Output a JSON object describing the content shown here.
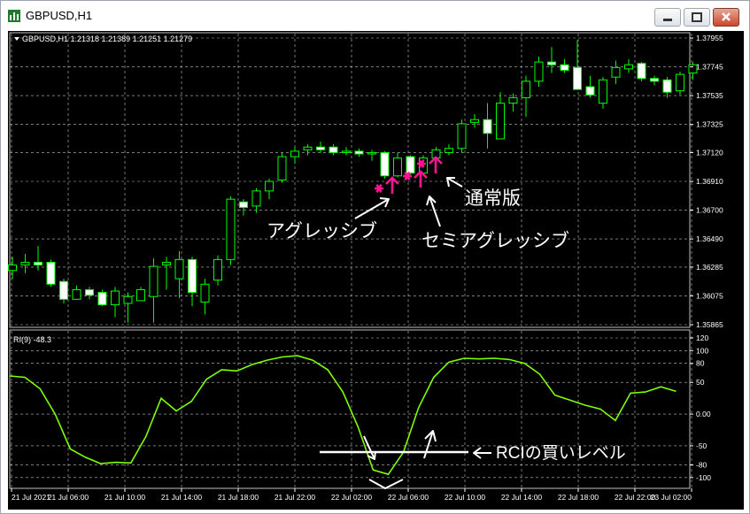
{
  "window": {
    "title": "GBPUSD,H1"
  },
  "colors": {
    "background": "#000000",
    "grid": "#c0c0c0",
    "candle_outline": "#00ff00",
    "candle_up_fill": "#000000",
    "candle_down_fill": "#ffffff",
    "rci_line": "#7fff00",
    "marker": "#ff1493",
    "annotation": "#ffffff"
  },
  "chart_data": [
    {
      "type": "candlestick",
      "symbol_header": "GBPUSD,H1  1.21318 1.21389 1.21251 1.21279",
      "ylim": [
        1.35865,
        1.37955
      ],
      "y_ticks": [
        "1.37955",
        "1.37745",
        "1.37535",
        "1.37325",
        "1.37120",
        "1.36910",
        "1.36700",
        "1.36490",
        "1.36285",
        "1.36075",
        "1.35865"
      ],
      "x_ticks": [
        "21 Jul 2021",
        "21 Jul 06:00",
        "21 Jul 10:00",
        "21 Jul 14:00",
        "21 Jul 18:00",
        "21 Jul 22:00",
        "22 Jul 02:00",
        "22 Jul 06:00",
        "22 Jul 10:00",
        "22 Jul 14:00",
        "22 Jul 18:00",
        "22 Jul 22:00",
        "23 Jul 02:00"
      ],
      "candles": [
        [
          1.3626,
          1.3636,
          1.362,
          1.363
        ],
        [
          1.363,
          1.3638,
          1.3624,
          1.3632
        ],
        [
          1.3632,
          1.3644,
          1.3626,
          1.363
        ],
        [
          1.3632,
          1.3634,
          1.3614,
          1.3616
        ],
        [
          1.3618,
          1.362,
          1.3602,
          1.3605
        ],
        [
          1.3605,
          1.3615,
          1.3605,
          1.3612
        ],
        [
          1.3612,
          1.3614,
          1.3605,
          1.3608
        ],
        [
          1.361,
          1.3612,
          1.36,
          1.3601
        ],
        [
          1.3601,
          1.3614,
          1.3592,
          1.3611
        ],
        [
          1.3602,
          1.361,
          1.3588,
          1.3607
        ],
        [
          1.3604,
          1.3614,
          1.3604,
          1.3612
        ],
        [
          1.3607,
          1.3635,
          1.3588,
          1.3629
        ],
        [
          1.363,
          1.3636,
          1.3612,
          1.3632
        ],
        [
          1.362,
          1.364,
          1.3606,
          1.3634
        ],
        [
          1.3634,
          1.3636,
          1.36,
          1.361
        ],
        [
          1.3603,
          1.362,
          1.3594,
          1.3616
        ],
        [
          1.3619,
          1.3637,
          1.3615,
          1.3634
        ],
        [
          1.3634,
          1.368,
          1.363,
          1.3678
        ],
        [
          1.3676,
          1.3678,
          1.3666,
          1.3672
        ],
        [
          1.3673,
          1.3686,
          1.3668,
          1.3684
        ],
        [
          1.3684,
          1.3693,
          1.3678,
          1.3691
        ],
        [
          1.3692,
          1.3712,
          1.369,
          1.3709
        ],
        [
          1.3709,
          1.3716,
          1.3704,
          1.3713
        ],
        [
          1.3714,
          1.3718,
          1.371,
          1.3716
        ],
        [
          1.3716,
          1.372,
          1.3712,
          1.3714
        ],
        [
          1.3716,
          1.3718,
          1.371,
          1.3712
        ],
        [
          1.3712,
          1.3716,
          1.371,
          1.3713
        ],
        [
          1.3713,
          1.3715,
          1.3709,
          1.3711
        ],
        [
          1.3711,
          1.3714,
          1.3706,
          1.3712
        ],
        [
          1.3712,
          1.3713,
          1.3693,
          1.3695
        ],
        [
          1.3695,
          1.3712,
          1.3694,
          1.3708
        ],
        [
          1.3709,
          1.371,
          1.3696,
          1.3697
        ],
        [
          1.3697,
          1.371,
          1.3696,
          1.3708
        ],
        [
          1.3708,
          1.3716,
          1.3704,
          1.3714
        ],
        [
          1.3712,
          1.3718,
          1.371,
          1.3715
        ],
        [
          1.3715,
          1.3736,
          1.3712,
          1.3733
        ],
        [
          1.3734,
          1.374,
          1.373,
          1.3736
        ],
        [
          1.3736,
          1.3748,
          1.3715,
          1.3726
        ],
        [
          1.3722,
          1.3756,
          1.3722,
          1.3748
        ],
        [
          1.3748,
          1.3755,
          1.3742,
          1.3752
        ],
        [
          1.3752,
          1.3768,
          1.3738,
          1.3764
        ],
        [
          1.3764,
          1.3782,
          1.376,
          1.3778
        ],
        [
          1.3778,
          1.3789,
          1.377,
          1.3776
        ],
        [
          1.3776,
          1.378,
          1.377,
          1.3772
        ],
        [
          1.3774,
          1.3794,
          1.3758,
          1.3758
        ],
        [
          1.376,
          1.3768,
          1.3752,
          1.3754
        ],
        [
          1.3748,
          1.3767,
          1.3744,
          1.3765
        ],
        [
          1.3767,
          1.3779,
          1.3762,
          1.3774
        ],
        [
          1.3773,
          1.378,
          1.377,
          1.3776
        ],
        [
          1.3777,
          1.3778,
          1.3764,
          1.3766
        ],
        [
          1.3766,
          1.3768,
          1.3761,
          1.3764
        ],
        [
          1.3765,
          1.3767,
          1.3752,
          1.3756
        ],
        [
          1.3757,
          1.3771,
          1.3754,
          1.3769
        ],
        [
          1.377,
          1.3778,
          1.3765,
          1.3776
        ]
      ]
    },
    {
      "type": "line",
      "label": "RI(9) -48.3",
      "ylim": [
        -110,
        120
      ],
      "y_ticks": [
        "120",
        "100",
        "80",
        "50",
        "0.00",
        "-50",
        "-80",
        "-100"
      ],
      "values": [
        60,
        58,
        40,
        0,
        -55,
        -68,
        -78,
        -76,
        -77,
        -35,
        25,
        5,
        20,
        55,
        70,
        68,
        78,
        85,
        90,
        92,
        85,
        70,
        35,
        -20,
        -88,
        -95,
        -60,
        10,
        58,
        82,
        88,
        87,
        88,
        86,
        80,
        63,
        30,
        22,
        14,
        8,
        -10,
        33,
        35,
        43,
        36
      ]
    }
  ],
  "annotations": {
    "aggressive": "アグレッシブ",
    "semi_aggressive": "セミアグレッシブ",
    "normal": "通常版",
    "rci_buy_level": "RCIの買いレベル"
  }
}
